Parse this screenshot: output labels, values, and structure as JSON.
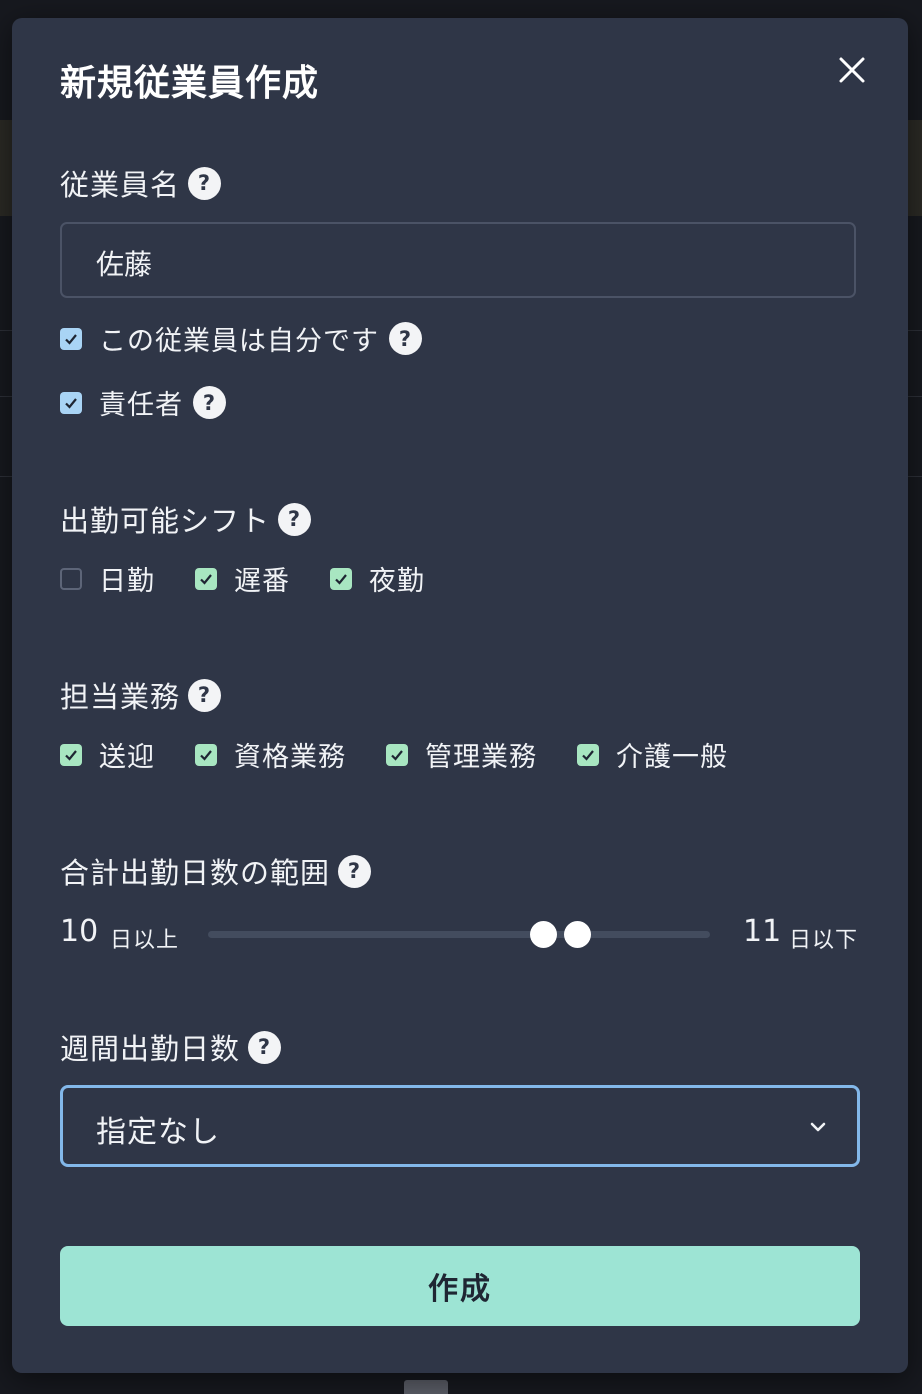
{
  "modal": {
    "title": "新規従業員作成",
    "close_icon": "close-icon"
  },
  "employee_name": {
    "label": "従業員名",
    "value": "佐藤"
  },
  "flags": {
    "is_self": {
      "label": "この従業員は自分です",
      "checked": true
    },
    "is_manager": {
      "label": "責任者",
      "checked": true
    }
  },
  "shifts": {
    "label": "出勤可能シフト",
    "options": [
      {
        "label": "日勤",
        "checked": false
      },
      {
        "label": "遅番",
        "checked": true
      },
      {
        "label": "夜勤",
        "checked": true
      }
    ]
  },
  "duties": {
    "label": "担当業務",
    "options": [
      {
        "label": "送迎",
        "checked": true
      },
      {
        "label": "資格業務",
        "checked": true
      },
      {
        "label": "管理業務",
        "checked": true
      },
      {
        "label": "介護一般",
        "checked": true
      }
    ]
  },
  "total_days": {
    "label": "合計出勤日数の範囲",
    "min_value": "10",
    "min_unit": "日以上",
    "max_value": "11",
    "max_unit": "日以下"
  },
  "weekly_days": {
    "label": "週間出勤日数",
    "selected": "指定なし"
  },
  "submit": {
    "label": "作成"
  },
  "help_glyph": "?",
  "colors": {
    "modal_bg": "#2f3647",
    "check_blue": "#a9d4f5",
    "check_green": "#a8e6c1",
    "focus_border": "#83b8ea",
    "submit_bg": "#9de4d4"
  }
}
